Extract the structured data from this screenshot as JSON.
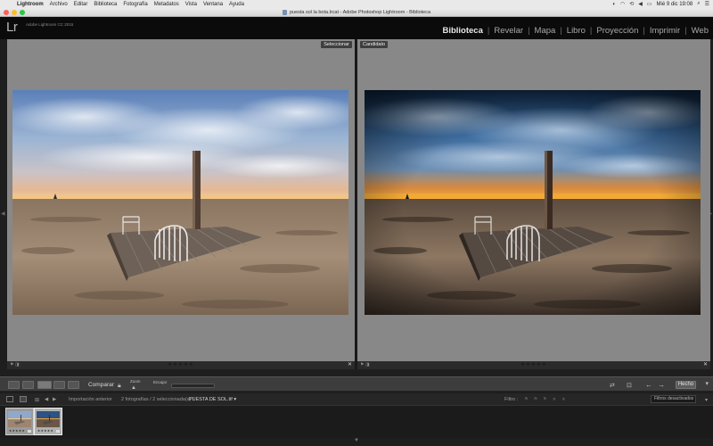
{
  "menubar": {
    "app": "Lightroom",
    "items": [
      "Archivo",
      "Editar",
      "Biblioteca",
      "Fotografía",
      "Metadatos",
      "Vista",
      "Ventana",
      "Ayuda"
    ],
    "clock": "Mié 9 dic  19:08"
  },
  "window": {
    "title": "puesta sol la bota.lrcat - Adobe Photoshop Lightroom - Biblioteca"
  },
  "identity": {
    "logo": "Lr",
    "version": "Adobe Lightroom CC 2015"
  },
  "modules": {
    "biblioteca": "Biblioteca",
    "revelar": "Revelar",
    "mapa": "Mapa",
    "libro": "Libro",
    "proyeccion": "Proyección",
    "imprimir": "Imprimir",
    "web": "Web"
  },
  "compare": {
    "select_label": "Seleccionar",
    "candidate_label": "Candidato",
    "select_stars": "★★★★★",
    "candidate_stars": "★★★★★"
  },
  "toolbar": {
    "compare_label": "Comparar",
    "zoom_label": "Zoom",
    "fit_label": "Encajar",
    "done_label": "Hecho"
  },
  "filmstrip": {
    "page1": "1",
    "page2": "2",
    "source": "Importación anterior",
    "selection_info": "2 fotografías / 2 seleccionada(s) /",
    "current_file": "PUESTA DE SOL.tif ▾",
    "filter_label": "Filtro :",
    "filter_value": "Filtros desactivados",
    "thumb1_stars": "★★★★★",
    "thumb2_stars": "★★★★★"
  },
  "colors": {
    "lr_bg": "#0b0b0b",
    "pane_bg": "#888888",
    "active_module": "#e8e8e8"
  }
}
